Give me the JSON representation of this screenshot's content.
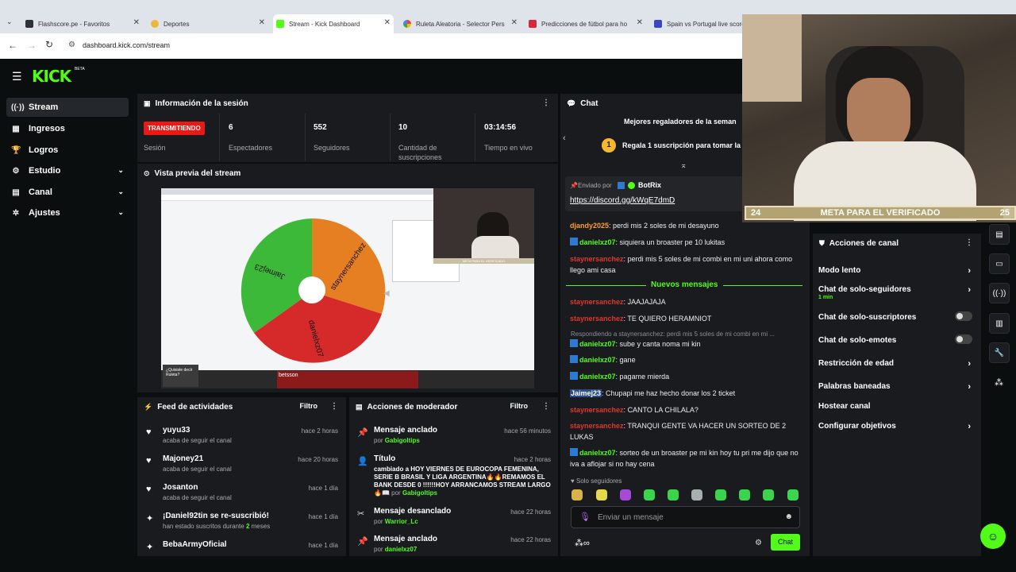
{
  "browser": {
    "tabs": [
      {
        "title": "Flashscore.pe - Favoritos",
        "color": "#2f3136"
      },
      {
        "title": "Deportes",
        "color": "#e9b93c"
      },
      {
        "title": "Stream - Kick Dashboard",
        "color": "#53fc18"
      },
      {
        "title": "Ruleta Aleatoria - Selector Pers",
        "color": "#4285f4"
      },
      {
        "title": "Predicciones de fútbol para ho",
        "color": "#d7263d"
      },
      {
        "title": "Spain vs Portugal live score",
        "color": "#3b46c4"
      }
    ],
    "url": "dashboard.kick.com/stream"
  },
  "kick": {
    "logo": "KICK",
    "beta": "BETA",
    "nav": [
      {
        "label": "Stream",
        "icon": "broadcast-icon"
      },
      {
        "label": "Ingresos",
        "icon": "revenue-icon"
      },
      {
        "label": "Logros",
        "icon": "trophy-icon"
      },
      {
        "label": "Estudio",
        "icon": "gear-icon"
      },
      {
        "label": "Canal",
        "icon": "channel-icon"
      },
      {
        "label": "Ajustes",
        "icon": "settings-icon"
      }
    ],
    "session": {
      "title": "Información de la sesión",
      "live_badge": "TRANSMITIENDO",
      "session_label": "Sesión",
      "stats": [
        {
          "value": "6",
          "label": "Espectadores"
        },
        {
          "value": "552",
          "label": "Seguidores"
        },
        {
          "value": "10",
          "label": "Cantidad de suscripciones"
        },
        {
          "value": "03:14:56",
          "label": "Tiempo en vivo"
        }
      ]
    },
    "preview": {
      "title": "Vista previa del stream",
      "wheel": {
        "segments": [
          {
            "label": "staynersanchez",
            "color": "#e67e22"
          },
          {
            "label": "danielxz07",
            "color": "#d62a2a"
          },
          {
            "label": "Jaimej23",
            "color": "#3db93a"
          }
        ]
      },
      "overlay_banner": "betsson",
      "pip_text": "¿Quisiste decir Ruleta?",
      "cam_caption": "META PARA EL VERIFICADO"
    },
    "feed": {
      "title": "Feed de actividades",
      "filter": "Filtro",
      "items": [
        {
          "name": "yuyu33",
          "sub": "acaba de seguir el canal",
          "time": "hace 2 horas",
          "icon": "heart-icon"
        },
        {
          "name": "Majoney21",
          "sub": "acaba de seguir el canal",
          "time": "hace 20 horas",
          "icon": "heart-icon"
        },
        {
          "name": "Josanton",
          "sub": "acaba de seguir el canal",
          "time": "hace 1 día",
          "icon": "heart-icon"
        },
        {
          "name": "¡Daniel92tin se re-suscribió!",
          "sub_pre": "han estado suscritos durante ",
          "sub_num": "2",
          "sub_post": " meses",
          "time": "hace 1 día",
          "icon": "sparkle-icon"
        },
        {
          "name": "BebaArmyOficial",
          "sub": "",
          "time": "hace 1 día",
          "icon": "sparkle-icon"
        }
      ]
    },
    "mod": {
      "title": "Acciones de moderador",
      "filter": "Filtro",
      "items": [
        {
          "action": "Mensaje anclado",
          "by_pre": "por ",
          "by": "Gabigoltips",
          "time": "hace 56 minutos",
          "icon": "pin-icon"
        },
        {
          "action": "Título",
          "desc": "cambiado a HOY VIERNES DE EUROCOPA FEMENINA, SERIE B BRASIL Y LIGA ARGENTINA🔥🔥REMAMOS EL BANK DESDE 0 !!!!!!HOY ARRANCAMOS STREAM LARGO 🔥📖",
          "by_pre": "por ",
          "by": "Gabigoltips",
          "time": "hace 2 horas",
          "icon": "user-edit-icon"
        },
        {
          "action": "Mensaje desanclado",
          "by_pre": "por ",
          "by": "Warrior_Lc",
          "time": "hace 22 horas",
          "icon": "unpin-icon"
        },
        {
          "action": "Mensaje anclado",
          "by_pre": "por ",
          "by": "danielxz07",
          "time": "hace 22 horas",
          "icon": "pin-icon"
        }
      ]
    },
    "chat": {
      "title": "Chat",
      "gifters_title": "Mejores regaladores de la seman",
      "gifters_rank": "1",
      "gifters_text": "Regala 1 suscripción para tomar la p",
      "pinned_by_label": "Enviado por",
      "pinned_by": "BotRix",
      "pinned_link": "https://discord.gg/kWqE7dmD",
      "new_messages": "Nuevos mensajes",
      "reply_hint": "Respondiendo a staynersanchez: perdi mis 5 soles de mi combi en mi ...",
      "messages_before": [
        {
          "user": "djandy2025",
          "text": "perdi mis 2 soles de mi desayuno",
          "color": "orange",
          "badge": false
        },
        {
          "user": "danielxz07",
          "text": "siquiera un broaster pe 10 lukitas",
          "color": "green",
          "badge": true
        },
        {
          "user": "staynersanchez",
          "text": "perdi mis 5 soles de mi combi en mi uni ahora como llego ami casa",
          "color": "red",
          "badge": false
        }
      ],
      "messages_after": [
        {
          "user": "staynersanchez",
          "text": "JAAJAJAJA",
          "color": "red",
          "badge": false
        },
        {
          "user": "staynersanchez",
          "text": "TE QUIERO HERAMNIOT",
          "color": "red",
          "badge": false
        },
        {
          "user": "danielxz07",
          "text": "sube y canta noma mi kin",
          "color": "green",
          "badge": true
        },
        {
          "user": "danielxz07",
          "text": "gane",
          "color": "green",
          "badge": true
        },
        {
          "user": "danielxz07",
          "text": "pagame mierda",
          "color": "green",
          "badge": true
        },
        {
          "user": "Jaimej23",
          "text": "Chupapi me haz hecho donar los 2 ticket",
          "color": "blue",
          "badge": false
        },
        {
          "user": "staynersanchez",
          "text": "CANTO LA CHILALA?",
          "color": "red",
          "badge": false
        },
        {
          "user": "staynersanchez",
          "text": "TRANQUI GENTE VA HACER UN SORTEO DE 2 LUKAS",
          "color": "red",
          "badge": false
        },
        {
          "user": "danielxz07",
          "text": "sorteo de un broaster pe mi kin hoy tu pri me dijo que no iva a aflojar si no hay cena",
          "color": "green",
          "badge": true
        }
      ],
      "followers_only": "Solo seguidores",
      "input_placeholder": "Enviar un mensaje",
      "send_label": "Chat"
    },
    "channel_actions": {
      "title": "Acciones de canal",
      "items": [
        {
          "label": "Modo lento",
          "kind": "chevron",
          "sub": ""
        },
        {
          "label": "Chat de solo-seguidores",
          "kind": "chevron",
          "sub": "1 min"
        },
        {
          "label": "Chat de solo-suscriptores",
          "kind": "toggle",
          "sub": ""
        },
        {
          "label": "Chat de solo-emotes",
          "kind": "toggle",
          "sub": ""
        },
        {
          "label": "Restricción de edad",
          "kind": "chevron",
          "sub": ""
        },
        {
          "label": "Palabras baneadas",
          "kind": "chevron",
          "sub": ""
        },
        {
          "label": "Hostear canal",
          "kind": "none",
          "sub": ""
        },
        {
          "label": "Configurar objetivos",
          "kind": "chevron",
          "sub": ""
        }
      ]
    },
    "webcam": {
      "goal_text": "META PARA EL VERIFICADO",
      "goal_current": "24",
      "goal_target": "25"
    }
  },
  "colors": {
    "accent": "#53fc18",
    "live": "#e91916",
    "panel": "#191b1f",
    "bg": "#0b0e0f"
  }
}
